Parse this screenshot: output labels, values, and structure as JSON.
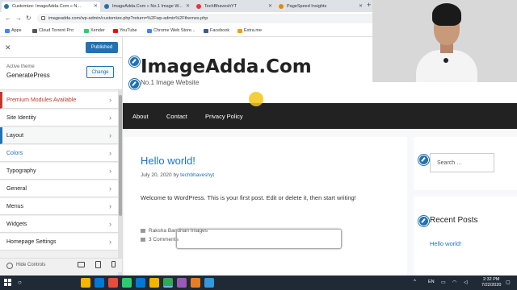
{
  "browser": {
    "tabs": [
      {
        "label": "Customize: ImageAdda.Com « N..."
      },
      {
        "label": "ImageAdda.Com « No.1 Image W..."
      },
      {
        "label": "TechBhaveshYT"
      },
      {
        "label": "PageSpeed Insights"
      }
    ],
    "new_tab": "+",
    "url": "imageadda.com/wp-admin/customize.php?return=%2Fwp-admin%2Fthemes.php",
    "bookmarks": [
      {
        "label": "Apps",
        "color": "#4285f4"
      },
      {
        "label": "Cloud Torrent Pro",
        "color": "#555555"
      },
      {
        "label": "Xender",
        "color": "#2ecc71"
      },
      {
        "label": "YouTube",
        "color": "#ff0000"
      },
      {
        "label": "Chrome Web Store...",
        "color": "#4285f4"
      },
      {
        "label": "Facebook",
        "color": "#3b5998"
      },
      {
        "label": "Extra.me",
        "color": "#f39c12"
      }
    ]
  },
  "customizer": {
    "close": "✕",
    "publish_label": "Published",
    "active_theme_label": "Active theme",
    "theme_name": "GeneratePress",
    "change_label": "Change",
    "sections": [
      {
        "label": "Premium Modules Available"
      },
      {
        "label": "Site Identity"
      },
      {
        "label": "Layout"
      },
      {
        "label": "Colors"
      },
      {
        "label": "Typography"
      },
      {
        "label": "General"
      },
      {
        "label": "Menus"
      },
      {
        "label": "Widgets"
      },
      {
        "label": "Homepage Settings"
      }
    ],
    "hide_controls": "Hide Controls"
  },
  "site": {
    "title": "ImageAdda.Com",
    "tagline": "No.1 Image Website",
    "menu": [
      {
        "label": "About"
      },
      {
        "label": "Contact"
      },
      {
        "label": "Privacy Policy"
      }
    ],
    "post": {
      "title": "Hello world!",
      "date": "July 20, 2020",
      "by": "by",
      "author": "techbhaveshyt",
      "body": "Welcome to WordPress. This is your first post. Edit or delete it, then start writing!",
      "category": "Raksha Bandhan Images",
      "comments": "3 Comments"
    },
    "search_placeholder": "Search …",
    "recent_posts_title": "Recent Posts",
    "recent_posts": [
      {
        "label": "Hello world!"
      }
    ]
  },
  "taskbar": {
    "lang": "EN",
    "time": "2:32 PM",
    "date": "7/22/2020",
    "app_colors": [
      "#f4b400",
      "#0078d7",
      "#e74c3c",
      "#2ecc71",
      "#0078d7",
      "#f4b400",
      "#34a853",
      "#9b59b6",
      "#e67e22",
      "#3498db"
    ]
  }
}
